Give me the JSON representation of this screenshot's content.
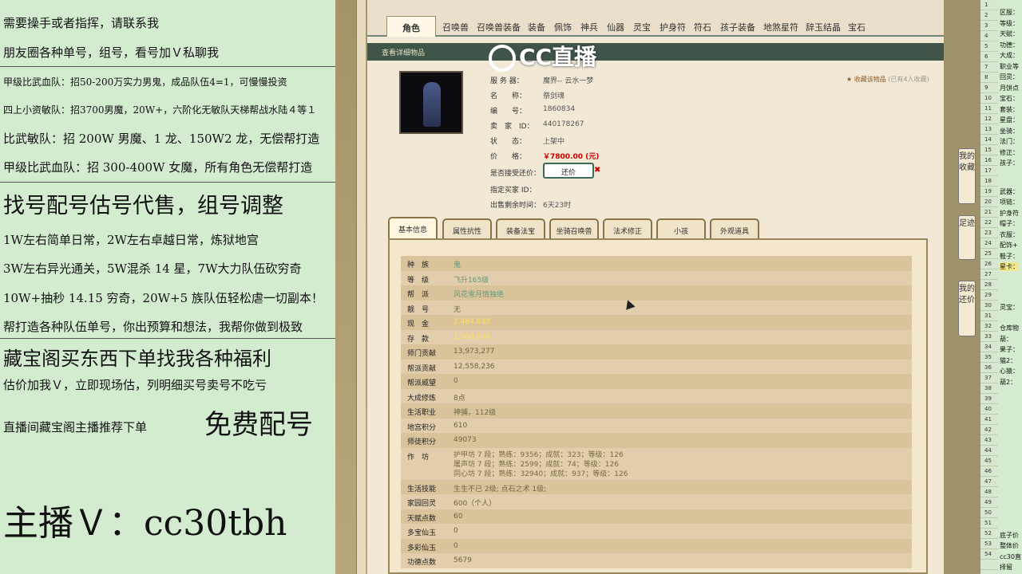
{
  "left_overlay": {
    "lines": [
      "需要操手或者指挥，请联系我",
      "朋友圈各种单号，组号，看号加Ｖ私聊我",
      "甲级比武血队：招50-200万实力男鬼，成品队伍4=1，可慢慢投资",
      "四上小资敏队：招3700男魔，20W+，六阶化无敏队天梯帮战水陆４等１",
      "比武敏队：招 200W 男魔、1 龙、150W2 龙，无偿帮打造",
      "甲级比武血队：招 300-400W 女魔，所有角色无偿帮打造",
      "找号配号估号代售，组号调整",
      "1W左右简单日常，2W左右卓越日常，炼狱地宫",
      "3W左右异光通关，5W混杀 14 星，7W大力队伍砍穷奇",
      "10W+抽秒 14.15 穷奇，20W+5 族队伍轻松虐一切副本！",
      "帮打造各种队伍单号，你出预算和想法，我帮你做到极致",
      "藏宝阁买东西下单找我各种福利",
      "估价加我Ｖ，立即现场估，列明细买号卖号不吃亏",
      "直播间藏宝阁主播推荐下单",
      "免费配号",
      "主播Ｖ：cc30tbh"
    ]
  },
  "tabs": [
    "角色",
    "召唤兽",
    "召唤兽装备",
    "装备",
    "佩饰",
    "神兵",
    "仙器",
    "灵宝",
    "护身符",
    "符石",
    "孩子装备",
    "地煞星符",
    "辞玉结晶",
    "宝石"
  ],
  "ribbon_title": "查看详细物品",
  "brand": "CC直播",
  "item": {
    "server_label": "服 务 器：",
    "server": "魔界-- 云水一梦",
    "name_label": "名　　称：",
    "name": "祭剑魂",
    "id_label": "编　　号：",
    "id": "1860834",
    "seller_label": "卖　家　ID：",
    "seller": "440178267",
    "status_label": "状　　态：",
    "status": "上架中",
    "price_label": "价　　格：",
    "price": "￥7800.00 (元)",
    "counter_label": "是否接受还价：",
    "counter_btn": "还价",
    "buyer_label": "指定买家 ID：",
    "remain_label": "出售剩余时间：",
    "remain": "6天23时",
    "fav_label": "收藏该物品",
    "fav_count": "(已有4人收藏)"
  },
  "subtabs": [
    "基本信息",
    "属性抗性",
    "装备法宝",
    "坐骑召唤兽",
    "法术修正",
    "小孩",
    "外观道具"
  ],
  "details": [
    {
      "k": "种　族",
      "v": "鬼"
    },
    {
      "k": "等　级",
      "v": "飞升165级"
    },
    {
      "k": "帮　派",
      "v": "风花雪月情独绝"
    },
    {
      "k": "靓　号",
      "v": "无"
    },
    {
      "k": "现　金",
      "v": "2,484,633"
    },
    {
      "k": "存　款",
      "v": "1,500,000"
    },
    {
      "k": "师门贡献",
      "v": "13,973,277"
    },
    {
      "k": "帮派贡献",
      "v": "12,558,236"
    },
    {
      "k": "帮派威望",
      "v": "0"
    },
    {
      "k": "大成修炼",
      "v": "8点"
    },
    {
      "k": "生活职业",
      "v": "神捕，112级"
    },
    {
      "k": "地宫积分",
      "v": "610"
    },
    {
      "k": "师徒积分",
      "v": "49073"
    }
  ],
  "workshop": {
    "k": "作　坊",
    "lines": [
      "护甲坊 7 段；熟练：9356；成就：323；等级：126",
      "屠声坊 7 段；熟练：2599；成就：74；等级：126",
      "同心坊 7 段；熟练：32940；成就：937；等级：126"
    ]
  },
  "details2": [
    {
      "k": "生活技能",
      "v": "生生不已 2级; 点石之术 1级;"
    },
    {
      "k": "家园回灵",
      "v": "600（个人）"
    },
    {
      "k": "天赋点数",
      "v": "60"
    },
    {
      "k": "多宝仙玉",
      "v": "0"
    },
    {
      "k": "多彩仙玉",
      "v": "0"
    },
    {
      "k": "功德点数",
      "v": "5679"
    }
  ],
  "side_buttons": [
    "我的收藏",
    "足迹",
    "我的还价"
  ],
  "right_labels": [
    "区服：",
    "等级：",
    "天赋：",
    "功德：",
    "大成：",
    "职业等",
    "回灵：",
    "月饼点",
    "宝石：",
    "套装：",
    "星盘：",
    "坐骑：",
    "法门：",
    "修正：",
    "孩子：",
    "武器：",
    "项链：",
    "护身符",
    "帽子：",
    "衣服：",
    "配饰+",
    "鞋子：",
    "星卡：",
    "灵宝：",
    "仓库物",
    "葫：",
    "果子：",
    "猫2：",
    "心猿：",
    "葫2：",
    "底子价",
    "整体价",
    "cc30直",
    "择留",
    "星卡",
    "月饼点数"
  ],
  "right_numbers": [
    "1",
    "2",
    "3",
    "4",
    "5",
    "6",
    "7",
    "8",
    "9",
    "10",
    "11",
    "12",
    "13",
    "14",
    "15",
    "16",
    "17",
    "18",
    "19",
    "20",
    "21",
    "22",
    "23",
    "24",
    "25",
    "26",
    "27",
    "28",
    "29",
    "30",
    "31",
    "32",
    "33",
    "34",
    "35",
    "36",
    "37",
    "38",
    "39",
    "40",
    "41",
    "42",
    "43",
    "44",
    "45",
    "46",
    "47",
    "48",
    "49",
    "50",
    "51",
    "52",
    "53",
    "54"
  ]
}
